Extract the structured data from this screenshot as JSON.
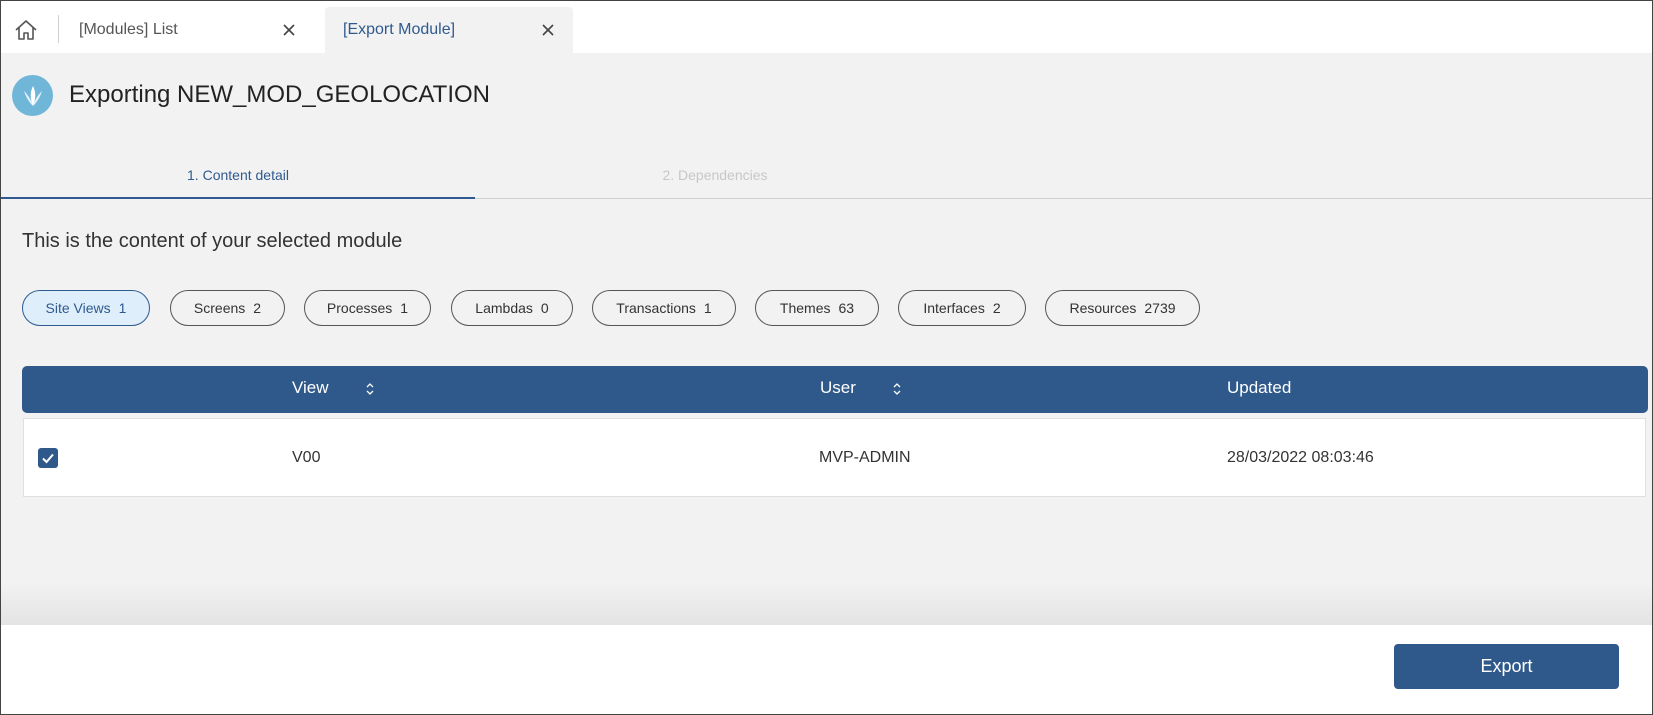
{
  "tabs": [
    {
      "label": "[Modules] List"
    },
    {
      "label": "[Export Module]"
    }
  ],
  "header": {
    "title": "Exporting NEW_MOD_GEOLOCATION"
  },
  "steps": [
    {
      "label": "1. Content detail"
    },
    {
      "label": "2. Dependencies"
    }
  ],
  "intro": "This is the content of your selected module",
  "chips": [
    {
      "label": "Site Views",
      "count": "1"
    },
    {
      "label": "Screens",
      "count": "2"
    },
    {
      "label": "Processes",
      "count": "1"
    },
    {
      "label": "Lambdas",
      "count": "0"
    },
    {
      "label": "Transactions",
      "count": "1"
    },
    {
      "label": "Themes",
      "count": "63"
    },
    {
      "label": "Interfaces",
      "count": "2"
    },
    {
      "label": "Resources",
      "count": "2739"
    }
  ],
  "table": {
    "columns": [
      "View",
      "User",
      "Updated"
    ],
    "rows": [
      {
        "view": "V00",
        "user": "MVP-ADMIN",
        "updated": "28/03/2022 08:03:46",
        "checked": true
      }
    ]
  },
  "footer": {
    "export_label": "Export"
  },
  "colors": {
    "primary": "#30598b",
    "accent": "#2f5a8f",
    "logo": "#6fb6d9",
    "chip_active_bg": "#dfeefb"
  },
  "icons": [
    "home-icon",
    "close-icon",
    "logo-icon",
    "sort-icon",
    "checkmark-icon"
  ]
}
